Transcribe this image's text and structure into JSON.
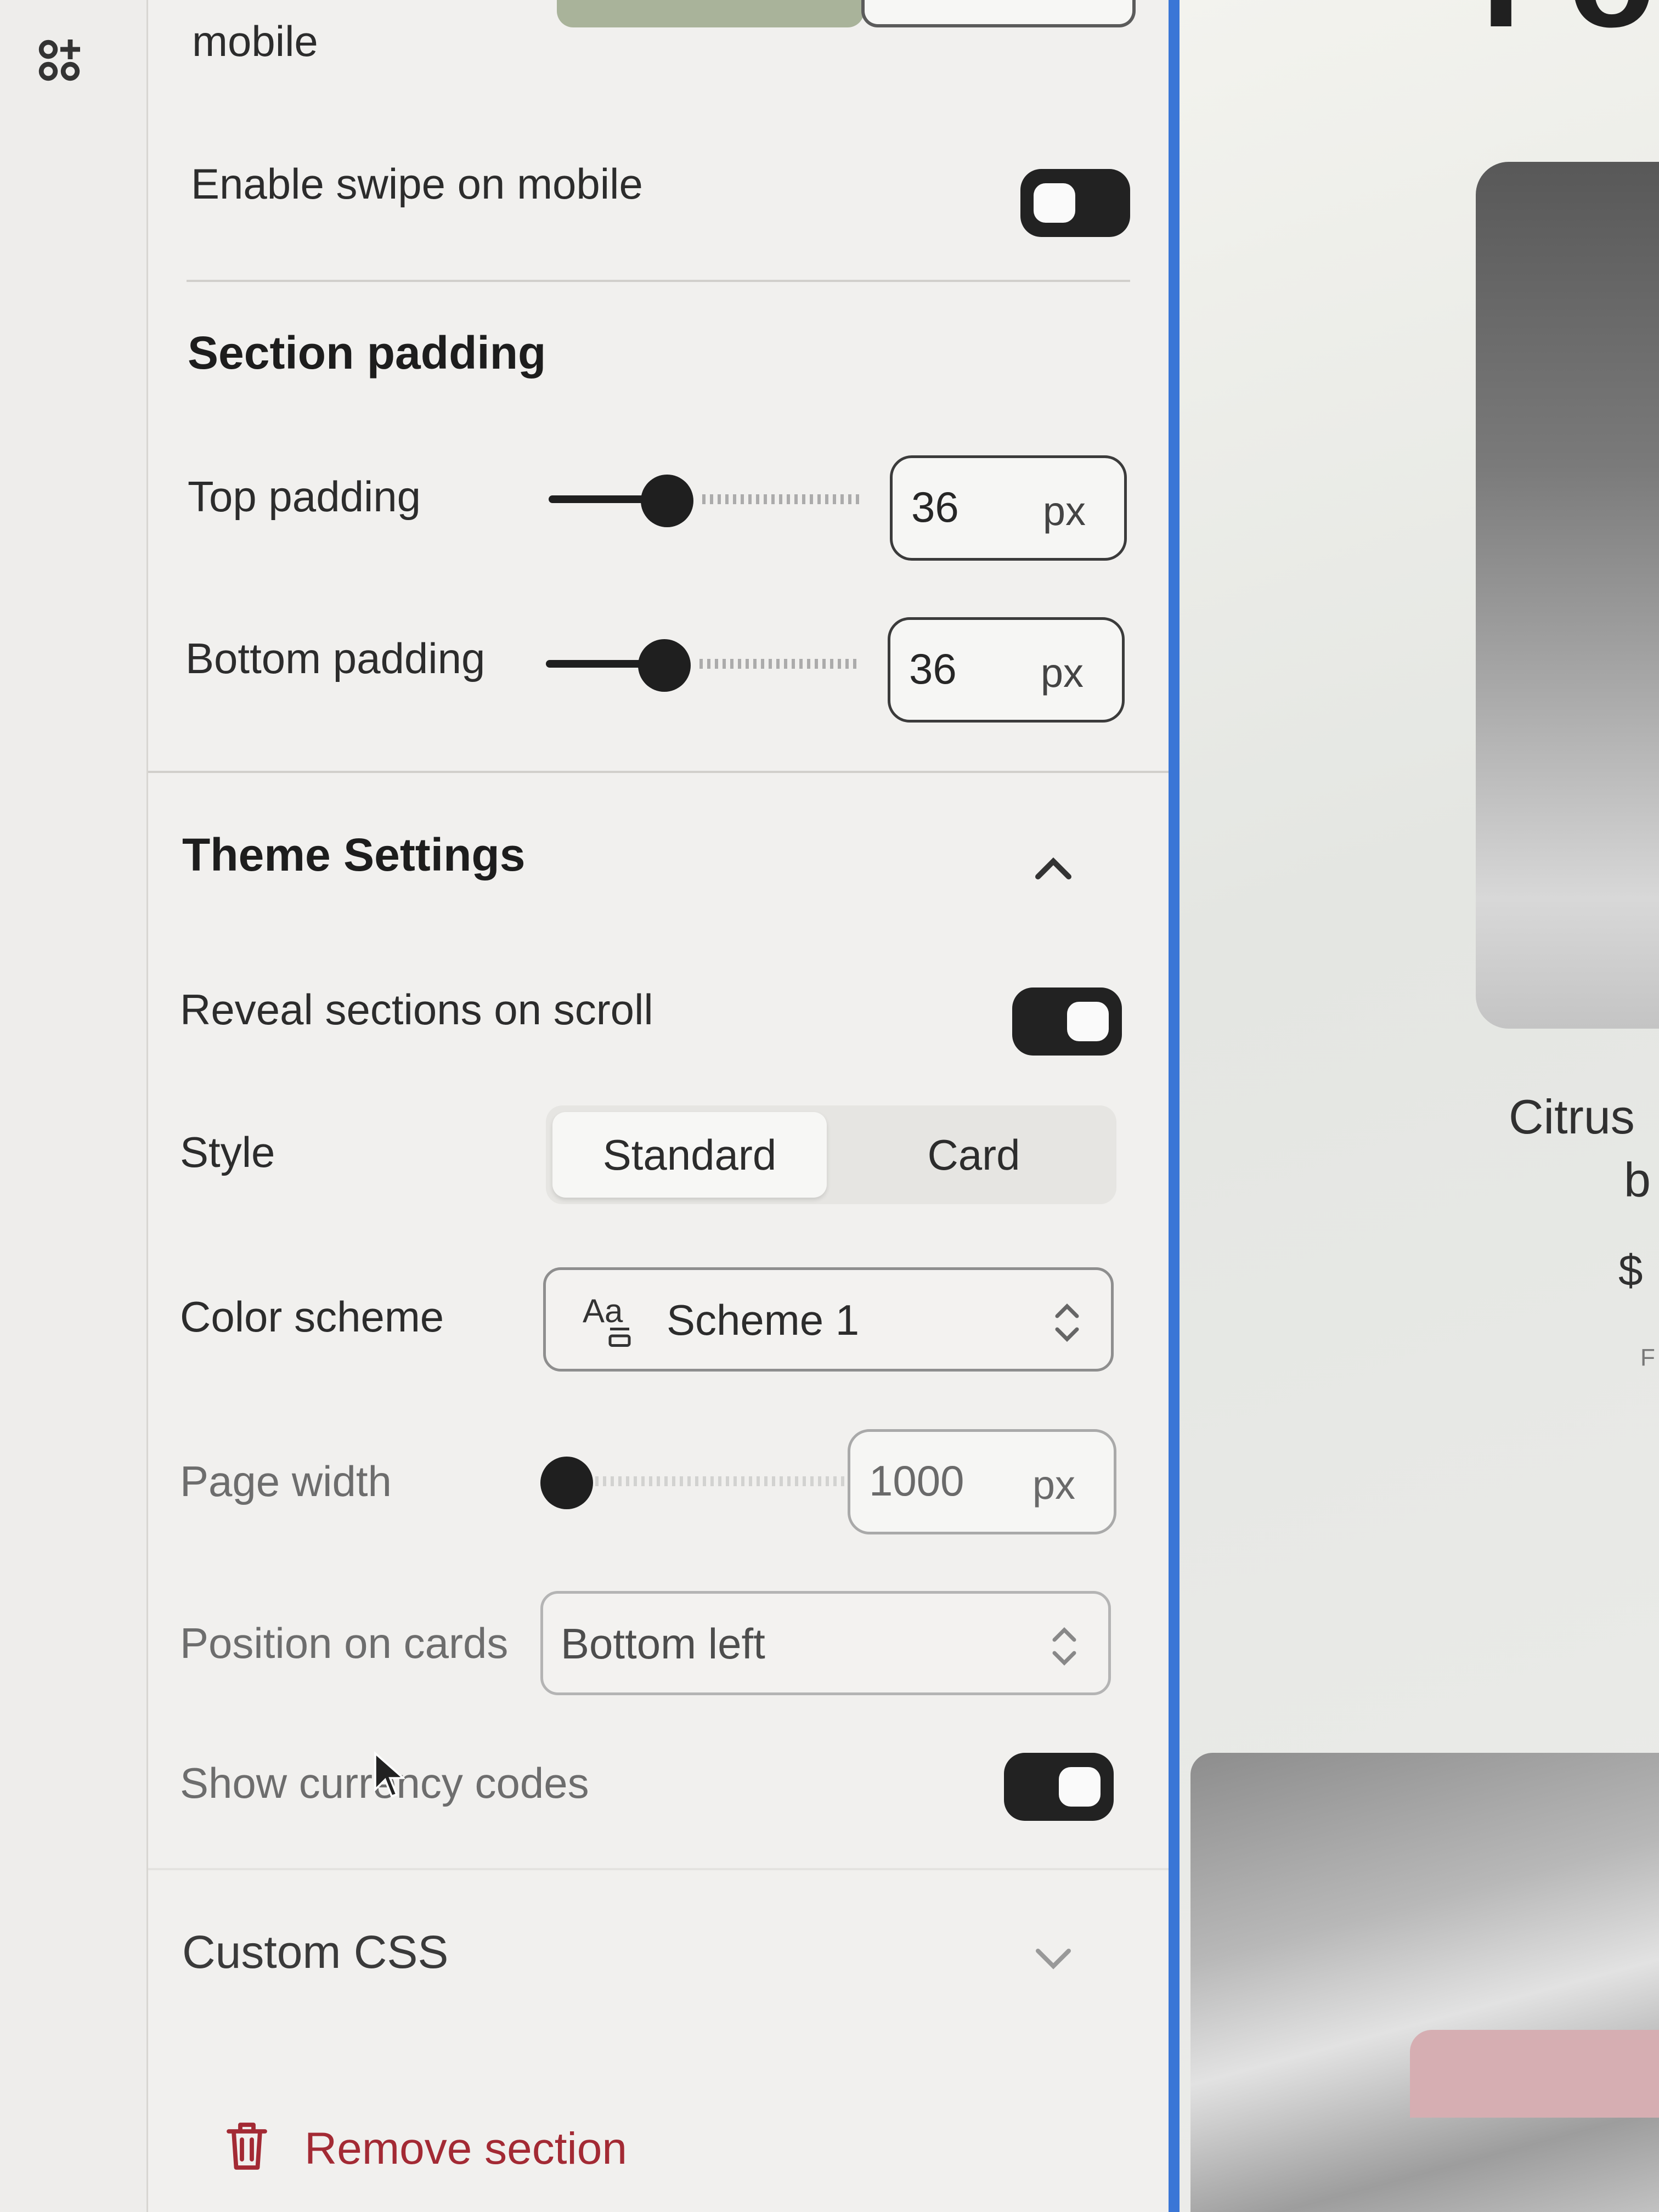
{
  "rail": {
    "apps_icon": "apps-plus-icon"
  },
  "panel": {
    "mobile_label": "mobile",
    "enable_swipe": {
      "label": "Enable swipe on mobile",
      "on": false
    },
    "section_padding": {
      "heading": "Section padding",
      "top": {
        "label": "Top padding",
        "value": "36",
        "unit": "px",
        "slider_fraction": 0.36
      },
      "bottom": {
        "label": "Bottom padding",
        "value": "36",
        "unit": "px",
        "slider_fraction": 0.36
      }
    },
    "theme_settings": {
      "heading": "Theme Settings",
      "collapse_icon": "chevron-up-icon",
      "reveal": {
        "label": "Reveal sections on scroll",
        "on": true
      },
      "style": {
        "label": "Style",
        "options": [
          "Standard",
          "Card"
        ],
        "selected": "Standard"
      },
      "color_scheme": {
        "label": "Color scheme",
        "value": "Scheme 1",
        "icon": "color-scheme-icon"
      },
      "page_width": {
        "label": "Page width",
        "value": "1000",
        "unit": "px",
        "slider_fraction": 0.0
      },
      "position_on_cards": {
        "label": "Position on cards",
        "value": "Bottom left"
      },
      "currency": {
        "label": "Show currency codes",
        "on": true
      }
    },
    "custom_css": {
      "heading": "Custom CSS",
      "expand_icon": "chevron-down-icon"
    },
    "remove_section": {
      "label": "Remove section",
      "icon": "trash-icon"
    }
  },
  "preview": {
    "big_text": "Fo",
    "product_title_line1": "Citrus",
    "product_title_line2": "b",
    "price": "$",
    "tiny_text": "F"
  },
  "colors": {
    "accent_blue": "#3a76d6",
    "danger": "#a32a34",
    "toggle": "#222222"
  }
}
